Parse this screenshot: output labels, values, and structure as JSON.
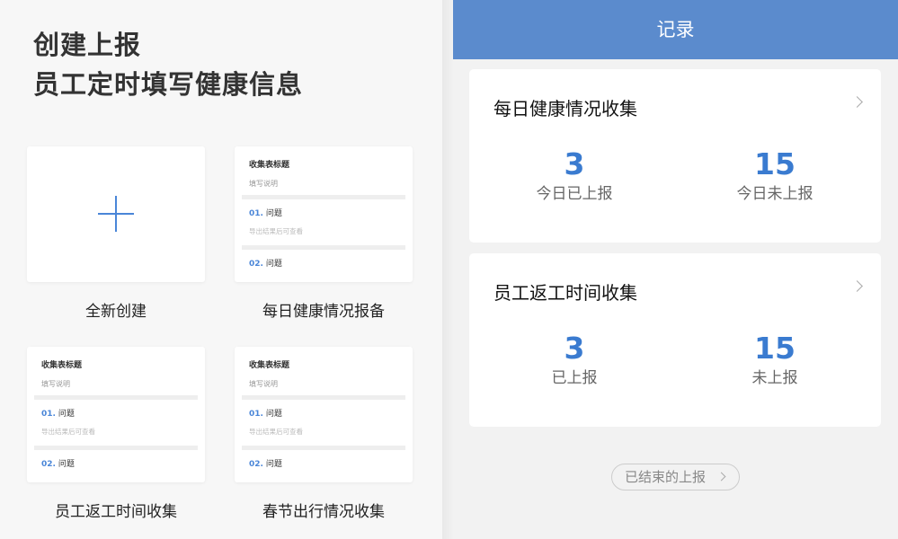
{
  "hero": {
    "line1": "创建上报",
    "line2": "员工定时填写健康信息"
  },
  "templates": [
    {
      "caption": "全新创建",
      "kind": "new"
    },
    {
      "caption": "每日健康情况报备",
      "kind": "form"
    },
    {
      "caption": "员工返工时间收集",
      "kind": "form"
    },
    {
      "caption": "春节出行情况收集",
      "kind": "form"
    }
  ],
  "template_preview": {
    "title": "收集表标题",
    "desc": "填写说明",
    "q1_num": "01.",
    "q1_label": "问题",
    "hint": "导出结果后可查看",
    "q2_num": "02.",
    "q2_label": "问题"
  },
  "right": {
    "header_title": "记录",
    "cards": [
      {
        "title": "每日健康情况收集",
        "stat_left": {
          "value": "3",
          "label": "今日已上报"
        },
        "stat_right": {
          "value": "15",
          "label": "今日未上报"
        }
      },
      {
        "title": "员工返工时间收集",
        "stat_left": {
          "value": "3",
          "label": "已上报"
        },
        "stat_right": {
          "value": "15",
          "label": "未上报"
        }
      }
    ],
    "ended_button": "已结束的上报"
  },
  "colors": {
    "accent": "#3a7bd0",
    "header_bg": "#5b8bcd",
    "plus": "#4a86d8"
  }
}
